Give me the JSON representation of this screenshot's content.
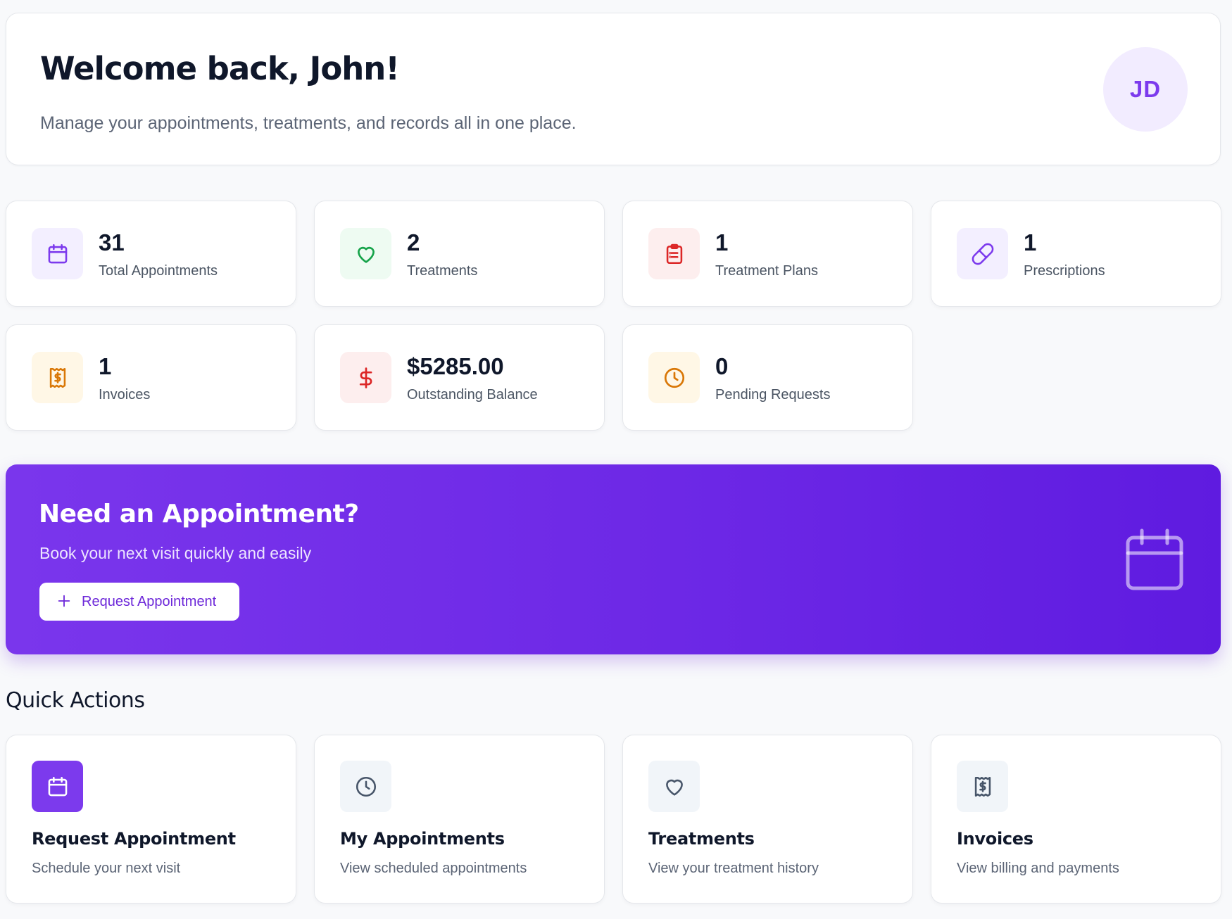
{
  "welcome": {
    "title": "Welcome back, John!",
    "subtitle": "Manage your appointments, treatments, and records all in one place.",
    "avatar_initials": "JD"
  },
  "stats": [
    {
      "value": "31",
      "label": "Total Appointments",
      "icon": "calendar-icon",
      "color": "#7c3aed",
      "bg": "#f3efff"
    },
    {
      "value": "2",
      "label": "Treatments",
      "icon": "heart-icon",
      "color": "#16a34a",
      "bg": "#eefbf2"
    },
    {
      "value": "1",
      "label": "Treatment Plans",
      "icon": "clipboard-icon",
      "color": "#dc2626",
      "bg": "#fdeeee"
    },
    {
      "value": "1",
      "label": "Prescriptions",
      "icon": "pill-icon",
      "color": "#7c3aed",
      "bg": "#f3efff"
    },
    {
      "value": "1",
      "label": "Invoices",
      "icon": "receipt-icon",
      "color": "#d97706",
      "bg": "#fff7e6"
    },
    {
      "value": "$5285.00",
      "label": "Outstanding Balance",
      "icon": "dollar-icon",
      "color": "#dc2626",
      "bg": "#fdeeee"
    },
    {
      "value": "0",
      "label": "Pending Requests",
      "icon": "clock-icon",
      "color": "#d97706",
      "bg": "#fff7e6"
    }
  ],
  "banner": {
    "title": "Need an Appointment?",
    "subtitle": "Book your next visit quickly and easily",
    "button_label": "Request Appointment"
  },
  "quick_actions": {
    "title": "Quick Actions",
    "items": [
      {
        "name": "Request Appointment",
        "desc": "Schedule your next visit",
        "icon": "calendar-icon"
      },
      {
        "name": "My Appointments",
        "desc": "View scheduled appointments",
        "icon": "clock-icon"
      },
      {
        "name": "Treatments",
        "desc": "View your treatment history",
        "icon": "heart-icon"
      },
      {
        "name": "Invoices",
        "desc": "View billing and payments",
        "icon": "receipt-icon"
      }
    ]
  },
  "colors": {
    "accent": "#7c3aed",
    "banner_gradient": [
      "#7a36ec",
      "#5f1be0"
    ],
    "text_primary": "#0f172a",
    "text_muted": "#5b6475"
  }
}
